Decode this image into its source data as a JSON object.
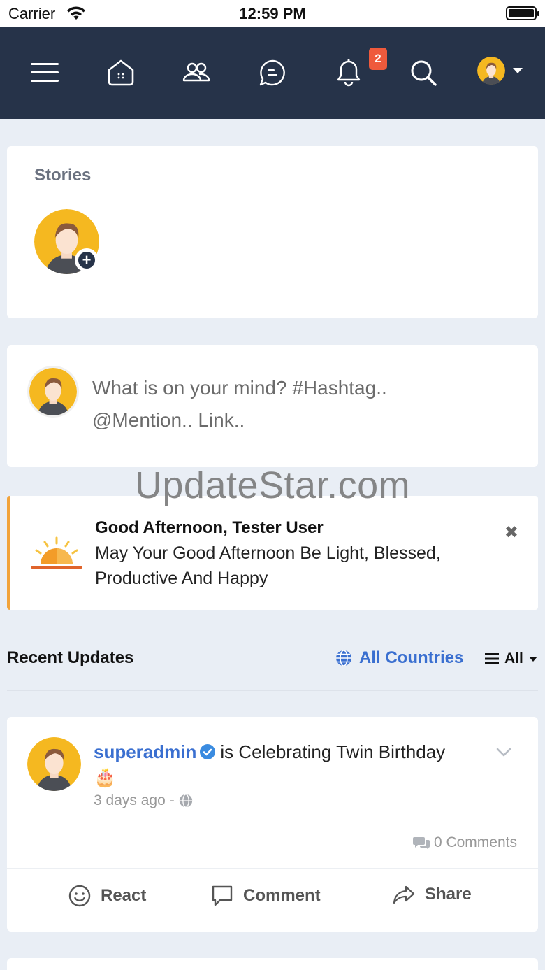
{
  "status_bar": {
    "carrier": "Carrier",
    "time": "12:59 PM"
  },
  "topnav": {
    "icons": [
      "menu-icon",
      "home-icon",
      "friends-icon",
      "messages-icon",
      "notifications-icon",
      "search-icon",
      "profile-avatar"
    ],
    "notification_count": "2"
  },
  "stories": {
    "title": "Stories"
  },
  "composer": {
    "placeholder": "What is on your mind? #Hashtag.. @Mention.. Link.."
  },
  "watermark": "UpdateStar.com",
  "greeting": {
    "title": "Good Afternoon, Tester User",
    "body": "May Your Good Afternoon Be Light, Blessed, Productive And Happy",
    "close": "✖"
  },
  "feed": {
    "title": "Recent Updates",
    "country_filter": "All Countries",
    "type_filter": "All"
  },
  "post": {
    "author": "superadmin",
    "activity": "is Celebrating Twin Birthday",
    "emoji": "🎂",
    "time": "3 days ago",
    "time_sep": "-",
    "comments": "0 Comments",
    "actions": {
      "react": "React",
      "comment": "Comment",
      "share": "Share"
    }
  },
  "colors": {
    "nav": "#263349",
    "accent": "#3a6fd0",
    "badge": "#ef5a3c",
    "greeting_border": "#f2a33a"
  }
}
